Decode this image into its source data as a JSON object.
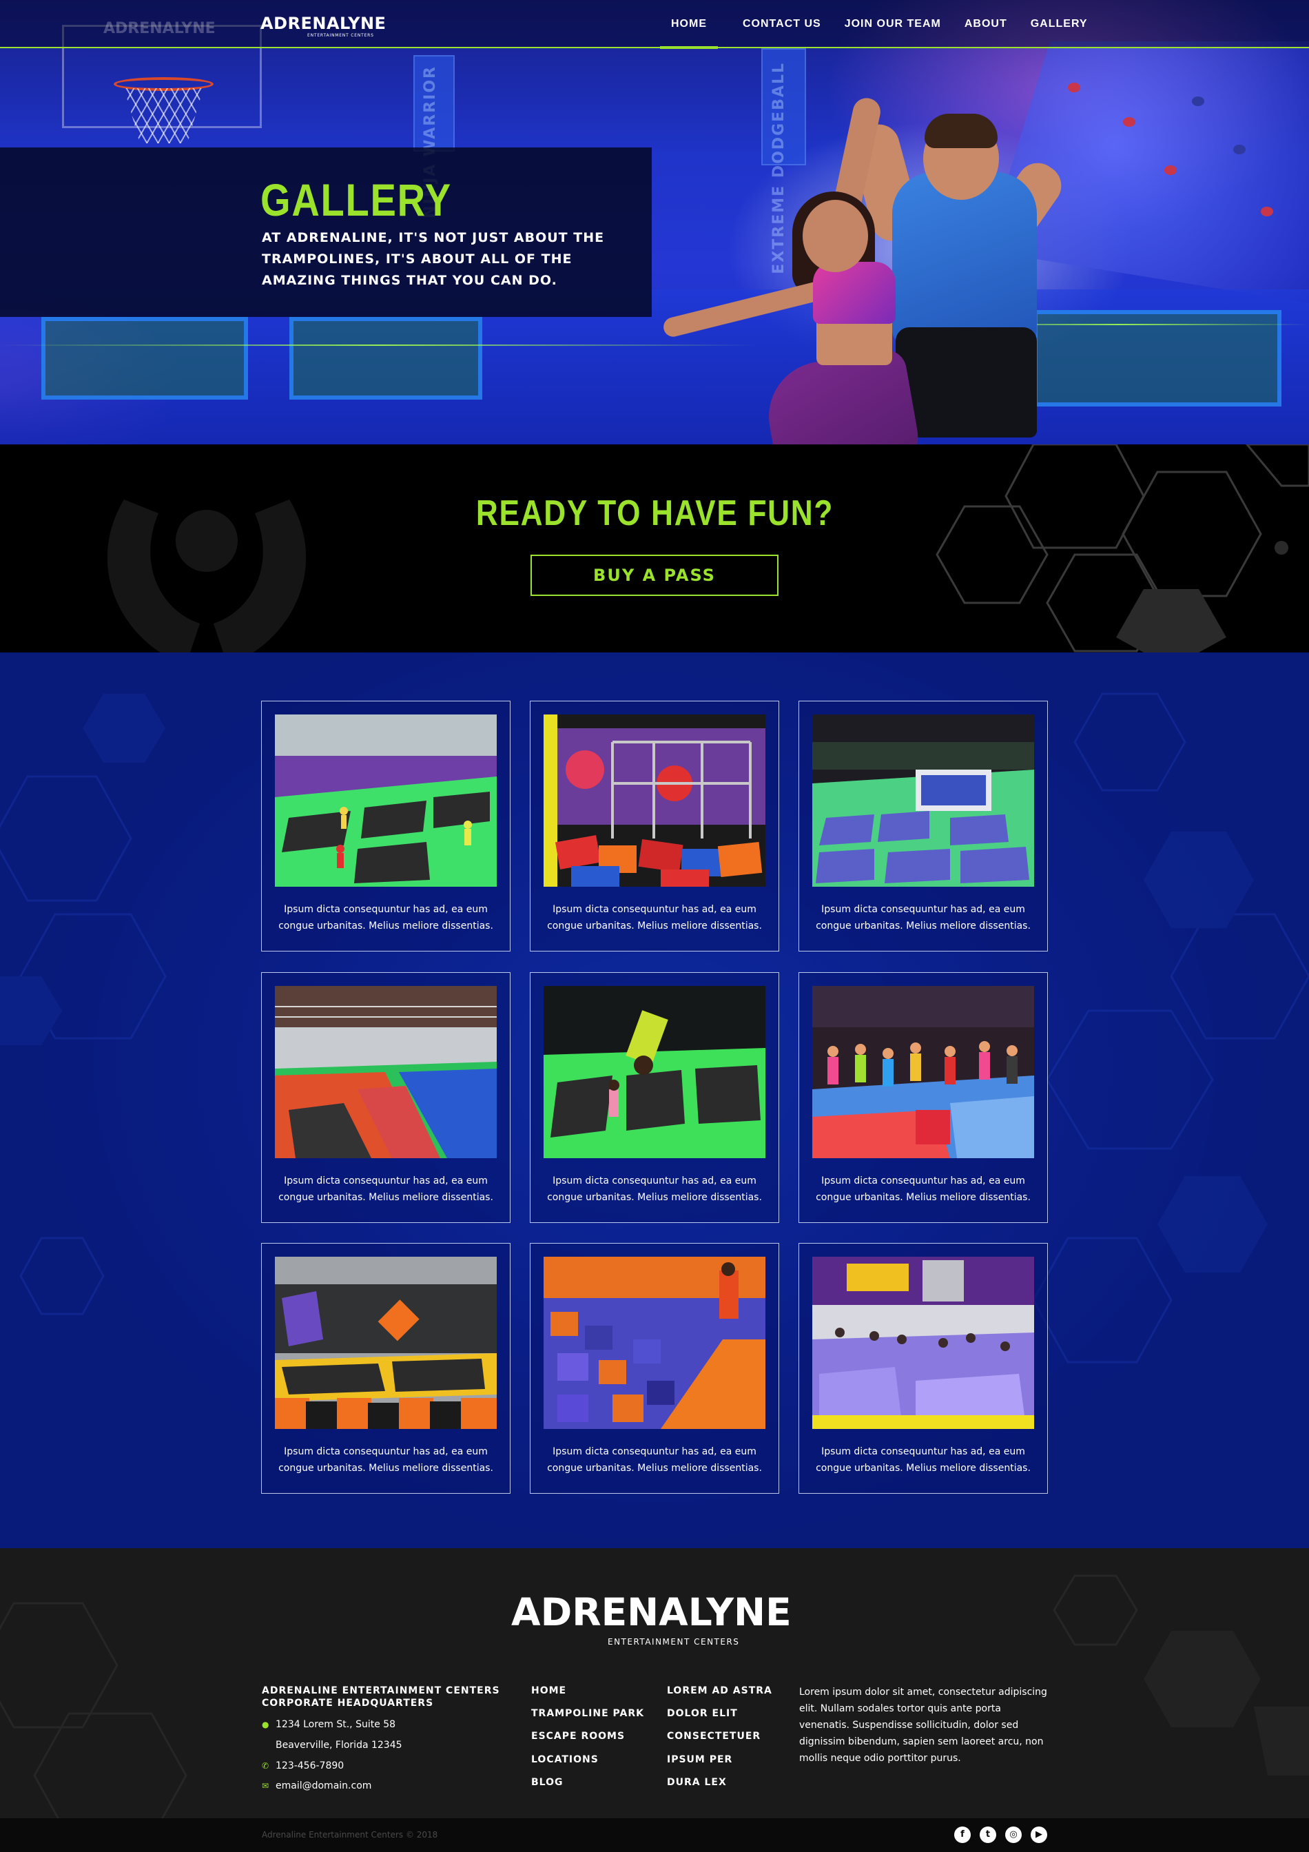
{
  "header": {
    "logo_text": "ADRENALYNE",
    "logo_subtitle": "ENTERTAINMENT CENTERS",
    "nav": [
      {
        "label": "HOME",
        "active": true
      },
      {
        "label": "CONTACT US",
        "active": false
      },
      {
        "label": "JOIN OUR TEAM",
        "active": false
      },
      {
        "label": "ABOUT",
        "active": false
      },
      {
        "label": "GALLERY",
        "active": false
      }
    ]
  },
  "hero": {
    "title": "GALLERY",
    "description": "AT ADRENALINE, IT'S NOT JUST ABOUT THE TRAMPOLINES, IT'S ABOUT ALL OF THE AMAZING THINGS THAT YOU CAN DO.",
    "wall_text_1": "EXTREME DODGEBALL",
    "wall_text_2": "NINJA WARRIOR"
  },
  "cta": {
    "title": "READY TO HAVE FUN?",
    "button_label": "BUY A PASS"
  },
  "gallery": {
    "items": [
      {
        "caption": "Ipsum dicta consequuntur has ad, ea eum congue urbanitas. Melius meliore dissentias.",
        "scene": "trampoline-court-green"
      },
      {
        "caption": "Ipsum dicta consequuntur has ad, ea eum congue urbanitas. Melius meliore dissentias.",
        "scene": "ninja-course-foam-pit"
      },
      {
        "caption": "Ipsum dicta consequuntur has ad, ea eum congue urbanitas. Melius meliore dissentias.",
        "scene": "trampoline-arena-foam-pit"
      },
      {
        "caption": "Ipsum dicta consequuntur has ad, ea eum congue urbanitas. Melius meliore dissentias.",
        "scene": "empty-trampoline-hall"
      },
      {
        "caption": "Ipsum dicta consequuntur has ad, ea eum congue urbanitas. Melius meliore dissentias.",
        "scene": "backflip-green-trampolines"
      },
      {
        "caption": "Ipsum dicta consequuntur has ad, ea eum congue urbanitas. Melius meliore dissentias.",
        "scene": "crowd-party-trampolines"
      },
      {
        "caption": "Ipsum dicta consequuntur has ad, ea eum congue urbanitas. Melius meliore dissentias.",
        "scene": "kids-jump-yellow-pads"
      },
      {
        "caption": "Ipsum dicta consequuntur has ad, ea eum congue urbanitas. Melius meliore dissentias.",
        "scene": "orange-beam-foam-pit"
      },
      {
        "caption": "Ipsum dicta consequuntur has ad, ea eum congue urbanitas. Melius meliore dissentias.",
        "scene": "purple-park-crowd"
      }
    ]
  },
  "footer": {
    "logo_text": "ADRENALYNE",
    "logo_subtitle": "ENTERTAINMENT CENTERS",
    "hq_title": "ADRENALINE ENTERTAINMENT CENTERS CORPORATE HEADQUARTERS",
    "address_line1": "1234 Lorem St., Suite 58",
    "address_line2": "Beaverville, Florida 12345",
    "phone": "123-456-7890",
    "email": "email@domain.com",
    "links_col1": [
      "HOME",
      "TRAMPOLINE PARK",
      "ESCAPE ROOMS",
      "LOCATIONS",
      "BLOG"
    ],
    "links_col2": [
      "LOREM AD ASTRA",
      "DOLOR ELIT",
      "CONSECTETUER",
      "IPSUM PER",
      "DURA LEX"
    ],
    "about": "Lorem ipsum dolor sit amet, consectetur adipiscing elit. Nullam sodales tortor quis ante porta venenatis. Suspendisse sollicitudin, dolor sed dignissim bibendum, sapien sem laoreet arcu, non mollis neque odio porttitor purus.",
    "copyright": "Adrenaline Entertainment Centers © 2018",
    "social": [
      {
        "icon": "facebook-icon",
        "glyph": "f"
      },
      {
        "icon": "twitter-icon",
        "glyph": "t"
      },
      {
        "icon": "instagram-icon",
        "glyph": "◎"
      },
      {
        "icon": "youtube-icon",
        "glyph": "▶"
      }
    ]
  },
  "colors": {
    "accent": "#9be22c",
    "gallery_bg": "#0a1e88",
    "footer_bg": "#1a1a1a",
    "cta_bg": "#000000"
  }
}
